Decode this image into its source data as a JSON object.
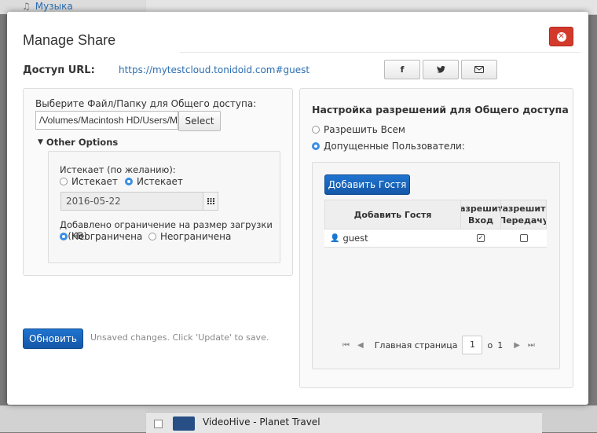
{
  "background": {
    "sidebar_item": "Музыка",
    "sidebar_icon": "music-note-icon",
    "row_name": "VideoHive - Planet Travel"
  },
  "modal": {
    "title": "Manage Share",
    "close_icon": "close-icon"
  },
  "access": {
    "label": "Доступ URL:",
    "url": "https://mytestcloud.tonidoid.com#guest",
    "share_buttons": [
      "f",
      "twitter",
      "email"
    ]
  },
  "left_panel": {
    "select_label": "Выберите Файл/Папку для Общего доступа:",
    "path_value": "/Volumes/Macintosh HD/Users/M",
    "select_button": "Select",
    "other_options": "Other Options",
    "expires_label": "Истекает (по желанию):",
    "expires_options": [
      "Истекает",
      "Истекает"
    ],
    "expires_selected_index": 1,
    "date_value": "2016-05-22",
    "limit_label": "Добавлено ограничение на размер загрузки в (KB)",
    "limit_options": [
      "Неограничена",
      "Неограничена"
    ],
    "limit_selected_index": 0
  },
  "footer": {
    "update_button": "Обновить",
    "unsaved_text": "Unsaved changes. Click 'Update' to save."
  },
  "right_panel": {
    "title": "Настройка разрешений для Общего доступа",
    "permission_options": [
      "Разрешить Всем",
      "Допущенные Пользователи:"
    ],
    "permission_selected_index": 1,
    "add_guest_button": "Добавить Гостя",
    "table": {
      "headers": [
        "Добавить Гостя",
        "Разрешить Вход",
        "Разрешить Передачу"
      ],
      "rows": [
        {
          "name": "guest",
          "login": true,
          "transfer": false
        }
      ]
    },
    "pager": {
      "label": "Главная страница",
      "page": "1",
      "of": "o",
      "total": "1"
    }
  }
}
